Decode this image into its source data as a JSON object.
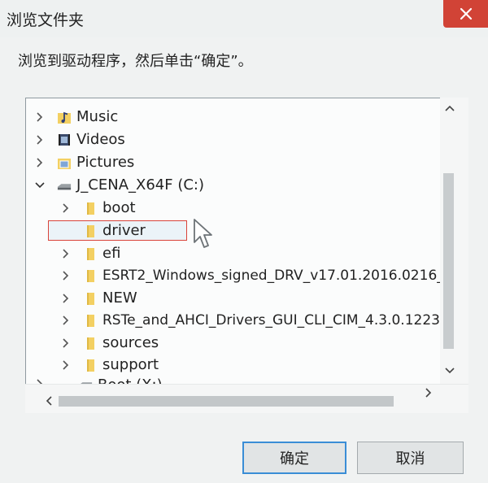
{
  "window": {
    "title": "浏览文件夹",
    "instruction": "浏览到驱动程序，然后单击“确定”。"
  },
  "tree": {
    "items": [
      {
        "label": "Music",
        "icon": "music-folder-icon",
        "expander": "collapsed"
      },
      {
        "label": "Videos",
        "icon": "videos-folder-icon",
        "expander": "collapsed"
      },
      {
        "label": "Pictures",
        "icon": "pictures-folder-icon",
        "expander": "collapsed"
      },
      {
        "label": "J_CENA_X64F (C:)",
        "icon": "drive-icon",
        "expander": "expanded"
      },
      {
        "label": "boot",
        "icon": "folder-icon",
        "expander": "collapsed"
      },
      {
        "label": "driver",
        "icon": "folder-icon",
        "expander": "none",
        "selected": true
      },
      {
        "label": "efi",
        "icon": "folder-icon",
        "expander": "collapsed"
      },
      {
        "label": "ESRT2_Windows_signed_DRV_v17.01.2016.0216_",
        "icon": "folder-icon",
        "expander": "collapsed"
      },
      {
        "label": "NEW",
        "icon": "folder-icon",
        "expander": "collapsed"
      },
      {
        "label": "RSTe_and_AHCI_Drivers_GUI_CLI_CIM_4.3.0.1223",
        "icon": "folder-icon",
        "expander": "collapsed"
      },
      {
        "label": "sources",
        "icon": "folder-icon",
        "expander": "collapsed"
      },
      {
        "label": "support",
        "icon": "folder-icon",
        "expander": "collapsed"
      },
      {
        "label": "Boot (X:)",
        "icon": "drive-icon",
        "expander": "collapsed"
      }
    ]
  },
  "buttons": {
    "ok": "确定",
    "cancel": "取消"
  },
  "colors": {
    "folder": "#f3d062",
    "selection_outline": "#d9443a",
    "ok_border": "#3a8dd6",
    "close": "#d14336"
  }
}
